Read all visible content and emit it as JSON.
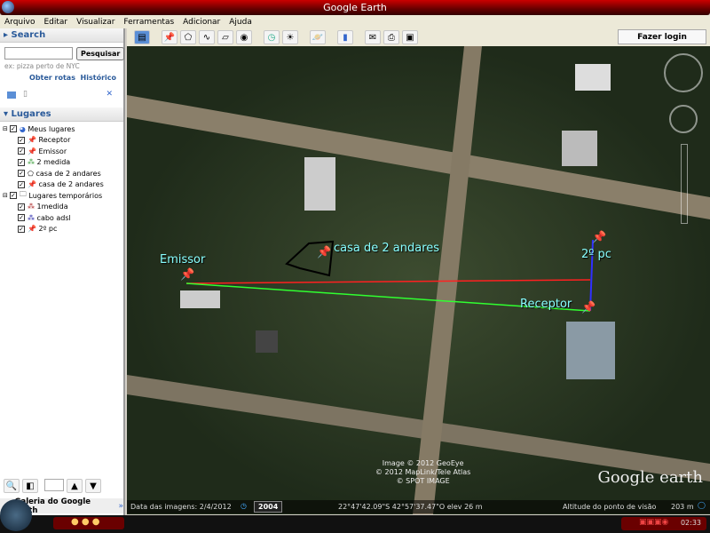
{
  "window": {
    "title": "Google Earth"
  },
  "menu": [
    "Arquivo",
    "Editar",
    "Visualizar",
    "Ferramentas",
    "Adicionar",
    "Ajuda"
  ],
  "toolbar": {
    "login_label": "Fazer login",
    "icons": [
      "sidebar-icon",
      "placemark-icon",
      "polygon-icon",
      "path-icon",
      "overlay-icon",
      "tour-icon",
      "history-icon",
      "sun-icon",
      "planet-icon",
      "ruler-icon",
      "email-icon",
      "print-icon",
      "maps-icon"
    ]
  },
  "search": {
    "header": "Search",
    "input_value": "",
    "button": "Pesquisar",
    "hint": "ex: pizza perto de NYC",
    "directions": "Obter rotas",
    "history": "Histórico"
  },
  "places": {
    "header": "Lugares",
    "tree": [
      {
        "label": "Meus lugares",
        "level": 0,
        "icon": "globe-icon"
      },
      {
        "label": "Receptor",
        "level": 1,
        "icon": "pushpin-icon"
      },
      {
        "label": "Emissor",
        "level": 1,
        "icon": "pushpin-icon"
      },
      {
        "label": "2 medida",
        "level": 1,
        "icon": "path-icon"
      },
      {
        "label": "casa de 2 andares",
        "level": 1,
        "icon": "polygon-icon"
      },
      {
        "label": "casa de 2 andares",
        "level": 1,
        "icon": "pushpin-icon"
      },
      {
        "label": "Lugares temporários",
        "level": 0,
        "icon": "folder-icon"
      },
      {
        "label": "1medida",
        "level": 1,
        "icon": "path-icon"
      },
      {
        "label": "cabo adsl",
        "level": 1,
        "icon": "path-icon"
      },
      {
        "label": "2º pc",
        "level": 1,
        "icon": "pushpin-icon"
      }
    ]
  },
  "gallery": {
    "label": "Galeria do Google Earth",
    "arrows": "»"
  },
  "map": {
    "labels": {
      "emissor": "Emissor",
      "casa": "casa de 2 andares",
      "pc2": "2º pc",
      "receptor": "Receptor"
    },
    "copyright": [
      "Image © 2012 GeoEye",
      "© 2012 MapLink/Tele Atlas",
      "© SPOT IMAGE"
    ],
    "logo": "Google earth",
    "line_colors": {
      "red": "#ff2020",
      "green": "#30ff30",
      "blue": "#3030ff"
    }
  },
  "status": {
    "date": "Data das imagens: 2/4/2012",
    "year": "2004",
    "coords": "22°47'42.09\"S  42°57'37.47\"O  elev   26 m",
    "altitude_label": "Altitude do ponto de visão",
    "altitude": "203 m"
  },
  "taskbar": {
    "clock": "02:33"
  }
}
